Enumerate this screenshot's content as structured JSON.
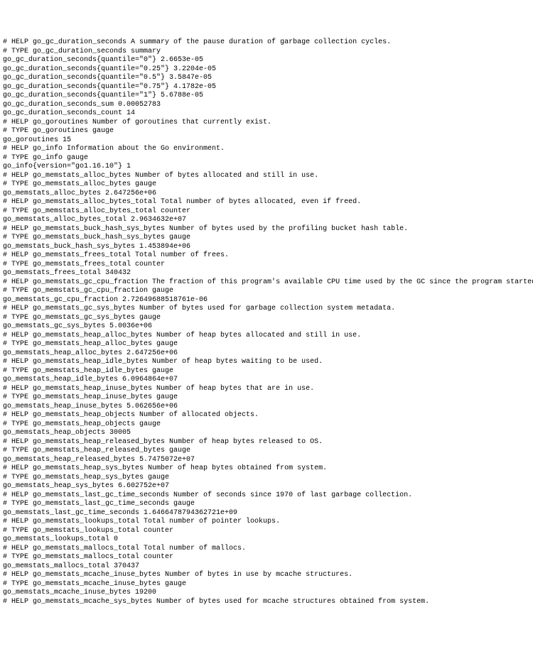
{
  "lines": [
    "# HELP go_gc_duration_seconds A summary of the pause duration of garbage collection cycles.",
    "# TYPE go_gc_duration_seconds summary",
    "go_gc_duration_seconds{quantile=\"0\"} 2.6653e-05",
    "go_gc_duration_seconds{quantile=\"0.25\"} 3.2204e-05",
    "go_gc_duration_seconds{quantile=\"0.5\"} 3.5847e-05",
    "go_gc_duration_seconds{quantile=\"0.75\"} 4.1782e-05",
    "go_gc_duration_seconds{quantile=\"1\"} 5.6788e-05",
    "go_gc_duration_seconds_sum 0.00052783",
    "go_gc_duration_seconds_count 14",
    "# HELP go_goroutines Number of goroutines that currently exist.",
    "# TYPE go_goroutines gauge",
    "go_goroutines 15",
    "# HELP go_info Information about the Go environment.",
    "# TYPE go_info gauge",
    "go_info{version=\"go1.16.10\"} 1",
    "# HELP go_memstats_alloc_bytes Number of bytes allocated and still in use.",
    "# TYPE go_memstats_alloc_bytes gauge",
    "go_memstats_alloc_bytes 2.647256e+06",
    "# HELP go_memstats_alloc_bytes_total Total number of bytes allocated, even if freed.",
    "# TYPE go_memstats_alloc_bytes_total counter",
    "go_memstats_alloc_bytes_total 2.9634632e+07",
    "# HELP go_memstats_buck_hash_sys_bytes Number of bytes used by the profiling bucket hash table.",
    "# TYPE go_memstats_buck_hash_sys_bytes gauge",
    "go_memstats_buck_hash_sys_bytes 1.453894e+06",
    "# HELP go_memstats_frees_total Total number of frees.",
    "# TYPE go_memstats_frees_total counter",
    "go_memstats_frees_total 340432",
    "# HELP go_memstats_gc_cpu_fraction The fraction of this program's available CPU time used by the GC since the program started.",
    "# TYPE go_memstats_gc_cpu_fraction gauge",
    "go_memstats_gc_cpu_fraction 2.72649688518761e-06",
    "# HELP go_memstats_gc_sys_bytes Number of bytes used for garbage collection system metadata.",
    "# TYPE go_memstats_gc_sys_bytes gauge",
    "go_memstats_gc_sys_bytes 5.0036e+06",
    "# HELP go_memstats_heap_alloc_bytes Number of heap bytes allocated and still in use.",
    "# TYPE go_memstats_heap_alloc_bytes gauge",
    "go_memstats_heap_alloc_bytes 2.647256e+06",
    "# HELP go_memstats_heap_idle_bytes Number of heap bytes waiting to be used.",
    "# TYPE go_memstats_heap_idle_bytes gauge",
    "go_memstats_heap_idle_bytes 6.0964864e+07",
    "# HELP go_memstats_heap_inuse_bytes Number of heap bytes that are in use.",
    "# TYPE go_memstats_heap_inuse_bytes gauge",
    "go_memstats_heap_inuse_bytes 5.062656e+06",
    "# HELP go_memstats_heap_objects Number of allocated objects.",
    "# TYPE go_memstats_heap_objects gauge",
    "go_memstats_heap_objects 30005",
    "# HELP go_memstats_heap_released_bytes Number of heap bytes released to OS.",
    "# TYPE go_memstats_heap_released_bytes gauge",
    "go_memstats_heap_released_bytes 5.7475072e+07",
    "# HELP go_memstats_heap_sys_bytes Number of heap bytes obtained from system.",
    "# TYPE go_memstats_heap_sys_bytes gauge",
    "go_memstats_heap_sys_bytes 6.602752e+07",
    "# HELP go_memstats_last_gc_time_seconds Number of seconds since 1970 of last garbage collection.",
    "# TYPE go_memstats_last_gc_time_seconds gauge",
    "go_memstats_last_gc_time_seconds 1.6466478794362721e+09",
    "# HELP go_memstats_lookups_total Total number of pointer lookups.",
    "# TYPE go_memstats_lookups_total counter",
    "go_memstats_lookups_total 0",
    "# HELP go_memstats_mallocs_total Total number of mallocs.",
    "# TYPE go_memstats_mallocs_total counter",
    "go_memstats_mallocs_total 370437",
    "# HELP go_memstats_mcache_inuse_bytes Number of bytes in use by mcache structures.",
    "# TYPE go_memstats_mcache_inuse_bytes gauge",
    "go_memstats_mcache_inuse_bytes 19200",
    "# HELP go_memstats_mcache_sys_bytes Number of bytes used for mcache structures obtained from system."
  ]
}
